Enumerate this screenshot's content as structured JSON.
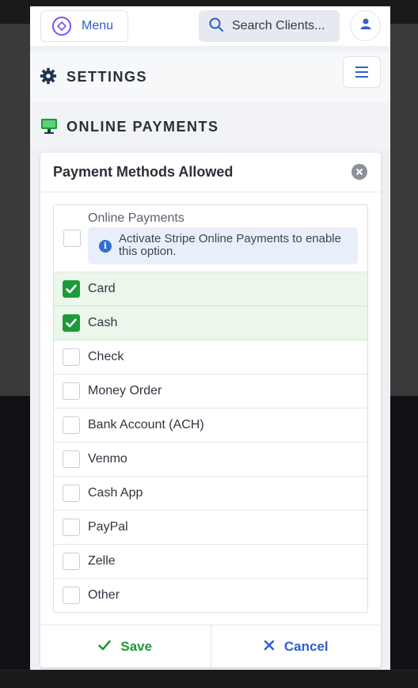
{
  "topbar": {
    "menu_label": "Menu",
    "search_placeholder": "Search Clients..."
  },
  "settings": {
    "title": "SETTINGS"
  },
  "section": {
    "title": "ONLINE PAYMENTS"
  },
  "modal": {
    "title": "Payment Methods Allowed",
    "online_payments": {
      "label": "Online Payments",
      "checked": false,
      "info": "Activate Stripe Online Payments to enable this option."
    },
    "methods": [
      {
        "label": "Card",
        "checked": true
      },
      {
        "label": "Cash",
        "checked": true
      },
      {
        "label": "Check",
        "checked": false
      },
      {
        "label": "Money Order",
        "checked": false
      },
      {
        "label": "Bank Account (ACH)",
        "checked": false
      },
      {
        "label": "Venmo",
        "checked": false
      },
      {
        "label": "Cash App",
        "checked": false
      },
      {
        "label": "PayPal",
        "checked": false
      },
      {
        "label": "Zelle",
        "checked": false
      },
      {
        "label": "Other",
        "checked": false
      }
    ],
    "save_label": "Save",
    "cancel_label": "Cancel"
  },
  "colors": {
    "accent_blue": "#2f5fd0",
    "check_green": "#1f9a3a",
    "checked_row_bg": "#eaf7ea"
  }
}
